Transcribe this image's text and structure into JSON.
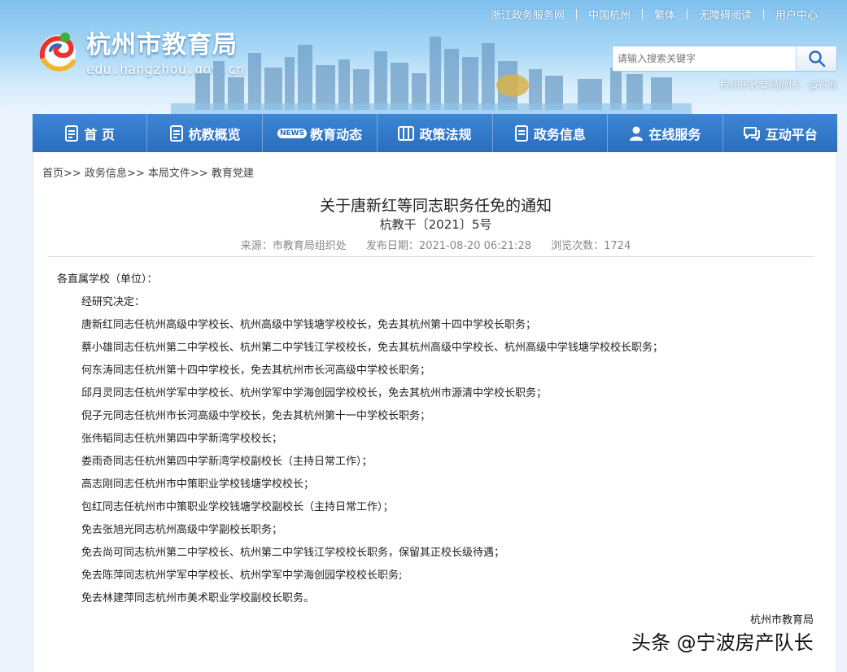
{
  "topbar": {
    "links": [
      "浙江政务服务网",
      "中国杭州",
      "繁体",
      "无障碍阅读",
      "用户中心"
    ]
  },
  "logo": {
    "title": "杭州市教育局",
    "url": "edu.hangzhou.gov.cn"
  },
  "search": {
    "placeholder": "请输入搜索关键字"
  },
  "weibo": "杭州市教育局微博：@新浪",
  "nav": {
    "items": [
      {
        "label": "首 页",
        "icon": "doc-icon"
      },
      {
        "label": "杭教概览",
        "icon": "doc-icon"
      },
      {
        "label": "教育动态",
        "icon": "news-icon"
      },
      {
        "label": "政策法规",
        "icon": "grid-icon"
      },
      {
        "label": "政务信息",
        "icon": "doc-icon"
      },
      {
        "label": "在线服务",
        "icon": "user-icon"
      },
      {
        "label": "互动平台",
        "icon": "chat-icon"
      }
    ],
    "news_tag": "NEWS"
  },
  "breadcrumb": [
    "首页",
    "政务信息",
    "本局文件",
    "教育党建"
  ],
  "article": {
    "title": "关于唐新红等同志职务任免的通知",
    "doc_number": "杭教干〔2021〕5号",
    "source": "来源：市教育局组织处",
    "date": "发布日期：2021-08-20 06:21:28",
    "views": "浏览次数：1724",
    "salutation": "各直属学校（单位）：",
    "intro": "经研究决定：",
    "lines": [
      "唐新红同志任杭州高级中学校长、杭州高级中学钱塘学校校长，免去其杭州第十四中学校长职务；",
      "蔡小雄同志任杭州第二中学校长、杭州第二中学钱江学校校长，免去其杭州高级中学校长、杭州高级中学钱塘学校校长职务；",
      "何东涛同志任杭州第十四中学校长，免去其杭州市长河高级中学校长职务；",
      "邱月灵同志任杭州学军中学校长、杭州学军中学海创园学校校长，免去其杭州市源清中学校长职务；",
      "倪子元同志任杭州市长河高级中学校长，免去其杭州第十一中学校长职务；",
      "张伟韬同志任杭州第四中学新湾学校校长；",
      "娄雨奇同志任杭州第四中学新湾学校副校长（主持日常工作）；",
      "高志刚同志任杭州市中策职业学校钱塘学校校长；",
      "包红同志任杭州市中策职业学校钱塘学校副校长（主持日常工作）；",
      "免去张旭光同志杭州高级中学副校长职务；",
      "免去尚可同志杭州第二中学校长、杭州第二中学钱江学校校长职务，保留其正校长级待遇；",
      "免去陈萍同志杭州学军中学校长、杭州学军中学海创园学校校长职务;",
      "免去林建萍同志杭州市美术职业学校副校长职务。"
    ],
    "signature": "杭州市教育局"
  },
  "watermark": "头条 @宁波房产队长",
  "colors": {
    "nav_top": "#3d87d6",
    "nav_bottom": "#2a6dbd",
    "header_sky": "#7fc0ee"
  }
}
